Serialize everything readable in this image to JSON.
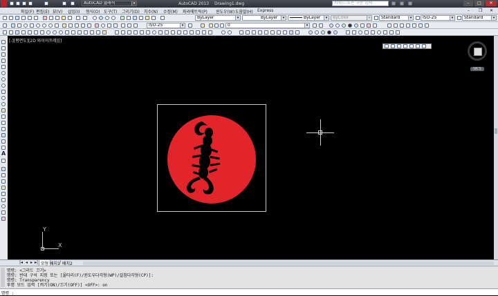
{
  "window": {
    "app_title": "AutoCAD 2013",
    "doc_title": "Drawing1.dwg",
    "workspace": "AutoCAD 클래식",
    "search_placeholder": "키워드 또는 구문 입력"
  },
  "menubar": {
    "items": [
      "파일(F)",
      "편집(E)",
      "뷰(V)",
      "삽입(I)",
      "형식(O)",
      "도구(T)",
      "그리기(D)",
      "치수(N)",
      "수정(M)",
      "파라메트릭(P)",
      "윈도우(W)",
      "도움말(H)",
      "Express"
    ]
  },
  "toolbar_props": {
    "layer_color": "ByLayer",
    "linetype": "ByLayer",
    "lineweight": "ByLayer",
    "plot_style": "ByColor",
    "text_style": "Standard",
    "dim_style": "ISO-25",
    "table_style": "Standard"
  },
  "toolbar_layers": {
    "layer_name": "0",
    "dim_style2": "ISO-25"
  },
  "viewport": {
    "label": "[-][평면도][2D 와이어프레임]",
    "viewcube_label": "WCS",
    "ucs_x": "X",
    "ucs_y": "Y"
  },
  "tabs": {
    "model": "모형",
    "layout1": "배치1",
    "layout2": "배치2"
  },
  "command": {
    "lines": [
      "명령: <그리드 끄기>",
      "명령: 반대 구석 지정 또는 [울타리(F)/윈도우다각형(WP)/걸침다각형(CP)]:",
      "명령: Transparency",
      "투명 모드 입력 [켜기(ON)/끄기(OFF)] <OFF>: on"
    ],
    "prompt": "명령 :"
  },
  "colors": {
    "emblem_red": "#e2252b",
    "frame_gray": "#c8c8c8"
  }
}
